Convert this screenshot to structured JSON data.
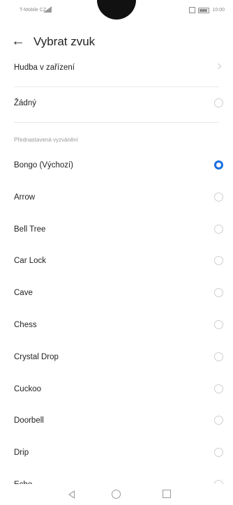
{
  "status_bar": {
    "carrier": "T-Mobile CZ",
    "time": "10:00"
  },
  "header": {
    "title": "Vybrat zvuk"
  },
  "device_music": {
    "label": "Hudba v zařízení"
  },
  "none_option": {
    "label": "Žádný"
  },
  "section": {
    "label": "Přednastavená vyzvánění"
  },
  "ringtones": [
    {
      "label": "Bongo (Výchozí)",
      "selected": true
    },
    {
      "label": "Arrow",
      "selected": false
    },
    {
      "label": "Bell Tree",
      "selected": false
    },
    {
      "label": "Car Lock",
      "selected": false
    },
    {
      "label": "Cave",
      "selected": false
    },
    {
      "label": "Chess",
      "selected": false
    },
    {
      "label": "Crystal Drop",
      "selected": false
    },
    {
      "label": "Cuckoo",
      "selected": false
    },
    {
      "label": "Doorbell",
      "selected": false
    },
    {
      "label": "Drip",
      "selected": false
    },
    {
      "label": "Echo",
      "selected": false
    }
  ],
  "colors": {
    "accent": "#1a6fe0",
    "divider": "#e8e8e8",
    "text": "#222222",
    "muted": "#9a9a9a"
  },
  "icons": {
    "back": "arrow-left-icon",
    "chevron": "chevron-right-icon",
    "nav_back": "triangle-back-icon",
    "nav_home": "circle-home-icon",
    "nav_recent": "square-recent-icon"
  }
}
